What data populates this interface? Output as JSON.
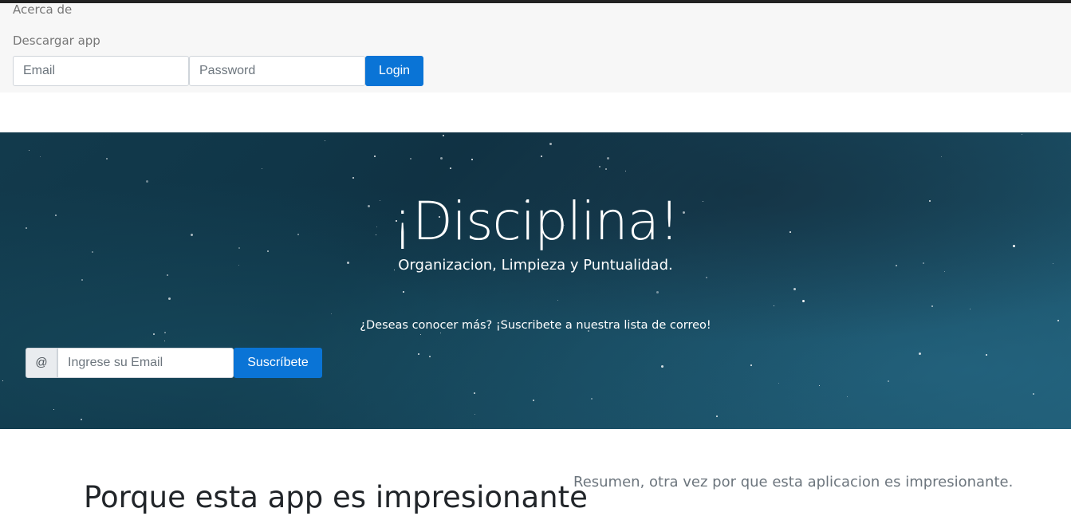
{
  "nav": {
    "about_label": "Acerca de",
    "download_label": "Descargar app"
  },
  "login": {
    "email_placeholder": "Email",
    "password_placeholder": "Password",
    "login_label": "Login"
  },
  "hero": {
    "title": "¡Disciplina!",
    "subtitle": "Organizacion, Limpieza y Puntualidad.",
    "cta_text": "¿Deseas conocer más? ¡Suscribete a nuestra lista de correo!",
    "at_symbol": "@",
    "subscribe_placeholder": "Ingrese su Email",
    "subscribe_label": "Suscríbete"
  },
  "features": {
    "heading": "Porque esta app es impresionante",
    "summary": "Resumen, otra vez por que esta aplicacion es impresionante."
  },
  "colors": {
    "primary": "#0a74d6",
    "navbar_bg": "#f7f7f7",
    "hero_bg": "#123a4c"
  }
}
